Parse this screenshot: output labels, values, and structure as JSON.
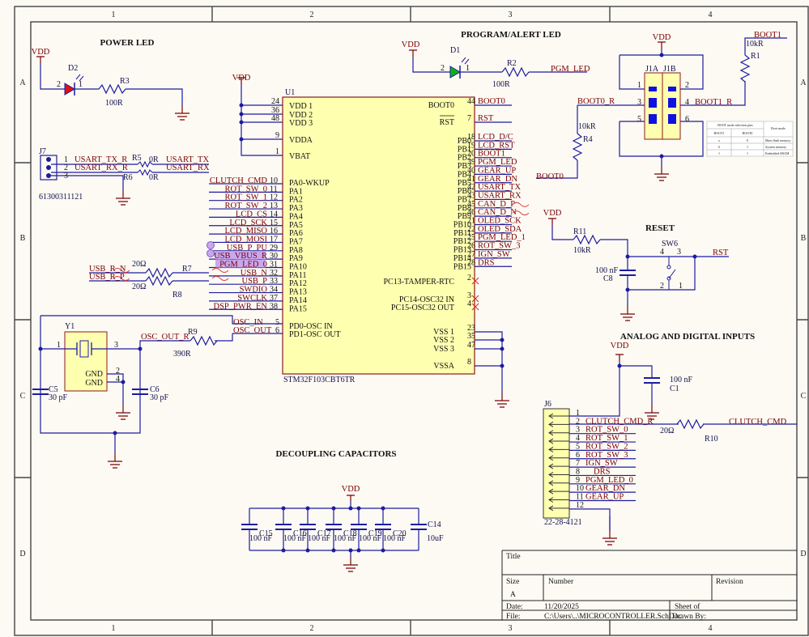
{
  "sheet": {
    "columns": [
      "1",
      "2",
      "3",
      "4"
    ],
    "rows": [
      "A",
      "B",
      "C",
      "D"
    ]
  },
  "sections": {
    "power_led": "POWER LED",
    "program_alert_led": "PROGRAM/ALERT LED",
    "reset": "RESET",
    "analog_digital_inputs": "ANALOG AND DIGITAL INPUTS",
    "decoupling_capacitors": "DECOUPLING CAPACITORS"
  },
  "power": {
    "vdd": "VDD"
  },
  "power_led": {
    "d2": "D2",
    "pin2": "2",
    "pin1": "1",
    "r3": "R3",
    "r3_value": "100R"
  },
  "program_led": {
    "d1": "D1",
    "pin2": "2",
    "pin1": "1",
    "r2": "R2",
    "r2_value": "100R",
    "net": "PGM_LED"
  },
  "j7": {
    "ref": "J7",
    "part": "61300311121",
    "pins": [
      "1",
      "2",
      "3"
    ],
    "net_tx_r": "USART_TX_R",
    "net_rx_r": "USART_RX_R",
    "r5": "R5",
    "r5_value": "0R",
    "r6": "R6",
    "r6_value": "0R",
    "net_tx": "USART_TX",
    "net_rx": "USART_RX"
  },
  "usb": {
    "net_n": "USB_R_N",
    "net_p": "USB_R_P",
    "r7": "R7",
    "r7_value": "20Ω",
    "r8": "R8",
    "r8_value": "20Ω"
  },
  "y1": {
    "ref": "Y1",
    "pin1": "1",
    "pin3": "3",
    "pin2": "2",
    "pin4": "4",
    "gnd1": "GND",
    "gnd2": "GND",
    "c5": "C5",
    "c5_value": "30 pF",
    "c6": "C6",
    "c6_value": "30 pF",
    "r9": "R9",
    "r9_value": "390R",
    "net_osc_out_r": "OSC_OUT_R"
  },
  "u1": {
    "ref": "U1",
    "part": "STM32F103CBT6TR",
    "power_pins": [
      {
        "num": "24",
        "name": "VDD 1"
      },
      {
        "num": "36",
        "name": "VDD 2"
      },
      {
        "num": "48",
        "name": "VDD 3"
      },
      {
        "num": "9",
        "name": "VDDA"
      },
      {
        "num": "1",
        "name": "VBAT"
      }
    ],
    "pa_pins": [
      {
        "num": "10",
        "name": "PA0-WKUP",
        "net": "CLUTCH_CMD"
      },
      {
        "num": "11",
        "name": "PA1",
        "net": "ROT_SW_0"
      },
      {
        "num": "12",
        "name": "PA2",
        "net": "ROT_SW_1"
      },
      {
        "num": "13",
        "name": "PA3",
        "net": "ROT_SW_2"
      },
      {
        "num": "14",
        "name": "PA4",
        "net": "LCD_CS"
      },
      {
        "num": "15",
        "name": "PA5",
        "net": "LCD_SCK"
      },
      {
        "num": "16",
        "name": "PA6",
        "net": "LCD_MISO"
      },
      {
        "num": "17",
        "name": "PA7",
        "net": "LCD_MOSI"
      },
      {
        "num": "29",
        "name": "PA8",
        "net": "USB_P_PU"
      },
      {
        "num": "30",
        "name": "PA9",
        "net": "USB_VBUS_R"
      },
      {
        "num": "31",
        "name": "PA10",
        "net": "PGM_LED_0"
      },
      {
        "num": "32",
        "name": "PA11",
        "net": "USB_N"
      },
      {
        "num": "33",
        "name": "PA12",
        "net": "USB_P"
      },
      {
        "num": "34",
        "name": "PA13",
        "net": "SWDIO"
      },
      {
        "num": "37",
        "name": "PA14",
        "net": "SWCLK"
      },
      {
        "num": "38",
        "name": "PA15",
        "net": "DSP_PWR_EN"
      }
    ],
    "osc_pins": [
      {
        "num": "5",
        "name": "PD0-OSC IN",
        "net": "OSC_IN"
      },
      {
        "num": "6",
        "name": "PD1-OSC OUT",
        "net": "OSC_OUT"
      }
    ],
    "boot_pins": [
      {
        "num": "44",
        "name": "BOOT0",
        "net": "BOOT0"
      },
      {
        "num": "7",
        "name": "RST",
        "net": "RST"
      }
    ],
    "pb_pins": [
      {
        "num": "18",
        "name": "PB0",
        "net": "LCD_D/C"
      },
      {
        "num": "19",
        "name": "PB1",
        "net": "LCD_RST"
      },
      {
        "num": "20",
        "name": "PB2",
        "net": "BOOT1"
      },
      {
        "num": "39",
        "name": "PB3",
        "net": "PGM_LED"
      },
      {
        "num": "40",
        "name": "PB4",
        "net": "GEAR_UP"
      },
      {
        "num": "41",
        "name": "PB5",
        "net": "GEAR_DN"
      },
      {
        "num": "42",
        "name": "PB6",
        "net": "USART_TX"
      },
      {
        "num": "43",
        "name": "PB7",
        "net": "USART_RX"
      },
      {
        "num": "45",
        "name": "PB8",
        "net": "CAN_D_P"
      },
      {
        "num": "46",
        "name": "PB9",
        "net": "CAN_D_N"
      },
      {
        "num": "21",
        "name": "PB10",
        "net": "OLED_SCK"
      },
      {
        "num": "22",
        "name": "PB11",
        "net": "OLED_SDA"
      },
      {
        "num": "25",
        "name": "PB12",
        "net": "PGM_LED_1"
      },
      {
        "num": "26",
        "name": "PB13",
        "net": "ROT_SW_3"
      },
      {
        "num": "27",
        "name": "PB14",
        "net": "IGN_SW"
      },
      {
        "num": "28",
        "name": "PB15",
        "net": "DRS"
      }
    ],
    "pc_pins": [
      {
        "num": "2",
        "name": "PC13-TAMPER-RTC"
      },
      {
        "num": "3",
        "name": "PC14-OSC32 IN"
      },
      {
        "num": "4",
        "name": "PC15-OSC32 OUT"
      }
    ],
    "vss_pins": [
      {
        "num": "23",
        "name": "VSS 1"
      },
      {
        "num": "35",
        "name": "VSS 2"
      },
      {
        "num": "47",
        "name": "VSS 3"
      },
      {
        "num": "8",
        "name": "VSSA"
      }
    ]
  },
  "j1": {
    "ref_a": "J1A",
    "ref_b": "J1B",
    "pins": [
      "1",
      "2",
      "3",
      "4",
      "5",
      "6"
    ],
    "net_boot0_r": "BOOT0_R",
    "net_boot1_r": "BOOT1_R",
    "r4": "R4",
    "r4_value": "10kR",
    "net_boot0": "BOOT0",
    "r1": "R1",
    "r1_value": "10kR",
    "net_boot1": "BOOT1"
  },
  "boot_table": {
    "title": "BOOT mode selection pins",
    "mode_header": "Boot mode",
    "col1": "BOOT1",
    "col2": "BOOT0",
    "rows": [
      [
        "x",
        "0",
        "Main flash memory"
      ],
      [
        "0",
        "1",
        "System memory"
      ],
      [
        "1",
        "1",
        "Embedded SRAM"
      ]
    ]
  },
  "reset": {
    "r11": "R11",
    "r11_value": "10kR",
    "c8": "C8",
    "c8_value": "100 nF",
    "sw6": "SW6",
    "pins": [
      "4",
      "3",
      "2",
      "1"
    ],
    "net": "RST"
  },
  "inputs": {
    "c1": "C1",
    "c1_value": "100 nF",
    "j6": "J6",
    "j6_part": "22-28-4121",
    "pins": [
      {
        "num": "1",
        "net": ""
      },
      {
        "num": "2",
        "net": "CLUTCH_CMD_R"
      },
      {
        "num": "3",
        "net": "ROT_SW_0"
      },
      {
        "num": "4",
        "net": "ROT_SW_1"
      },
      {
        "num": "5",
        "net": "ROT_SW_2"
      },
      {
        "num": "6",
        "net": "ROT_SW_3"
      },
      {
        "num": "7",
        "net": "IGN_SW"
      },
      {
        "num": "8",
        "net": "DRS"
      },
      {
        "num": "9",
        "net": "PGM_LED_0"
      },
      {
        "num": "10",
        "net": "GEAR_DN"
      },
      {
        "num": "11",
        "net": "GEAR_UP"
      },
      {
        "num": "12",
        "net": ""
      }
    ],
    "r10": "R10",
    "r10_value": "20Ω",
    "net_clutch": "CLUTCH_CMD"
  },
  "decoupling": {
    "caps": [
      {
        "ref": "C15",
        "value": "100 nF"
      },
      {
        "ref": "C16",
        "value": "100 nF"
      },
      {
        "ref": "C17",
        "value": "100 nF"
      },
      {
        "ref": "C18",
        "value": "100 nF"
      },
      {
        "ref": "C19",
        "value": "100 nF"
      },
      {
        "ref": "C20",
        "value": "100 nF"
      },
      {
        "ref": "C14",
        "value": "10uF"
      }
    ]
  },
  "title_block": {
    "title_label": "Title",
    "size_label": "Size",
    "size_value": "A",
    "number_label": "Number",
    "revision_label": "Revision",
    "date_label": "Date:",
    "date_value": "11/20/2025",
    "sheet_label": "Sheet   of",
    "file_label": "File:",
    "file_value": "C:\\Users\\..\\MICROCONTROLLER.SchDoc",
    "drawn_by_label": "Drawn By:"
  },
  "colors": {
    "wire": "#1c1ca0",
    "net_label": "#7a0000",
    "component_fill": "#ffffb0",
    "highlight": "#c7a8f0",
    "led_red": "#e01010",
    "led_green": "#10b010"
  }
}
